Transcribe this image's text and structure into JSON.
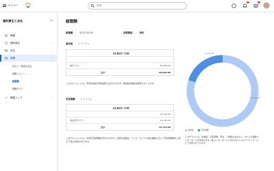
{
  "topbar": {
    "menu_label": "メニュー",
    "search_placeholder": "検索",
    "inbox_badge": "3",
    "notif_badge": "5"
  },
  "sidebar": {
    "title": "福利厚生と支払",
    "items": [
      {
        "label": "概要"
      },
      {
        "label": "福利厚生"
      },
      {
        "label": "支払"
      },
      {
        "label": "報酬"
      }
    ],
    "sub_items": [
      {
        "label": "賞与と一時金の支払"
      },
      {
        "label": "報酬レビュー..."
      },
      {
        "label": "総報酬"
      },
      {
        "label": "報酬サマリ"
      }
    ],
    "extra_item": {
      "label": "関連リンク"
    }
  },
  "main": {
    "title": "総報酬",
    "total_label": "総報酬",
    "total_value": "$75,125.00",
    "freq_label": "長期頻度",
    "freq_value": "毎年",
    "base": {
      "label": "基本給",
      "count": "2 アイテム",
      "header": "会社負担分 (目標)",
      "rows": [
        {
          "name": "",
          "value": ""
        },
        {
          "name": "給与プラン",
          "value": "60,000.00"
        }
      ],
      "total_label": "合計:",
      "total_value": "60,000.00"
    },
    "base_note": "このセクションには、年間基本給が現地通貨で表示されます。時給制労働者は概算されています。",
    "variable": {
      "label": "可変報酬",
      "count": "2 アイテム",
      "header": "会社負担分 (目標)",
      "rows": [
        {
          "name": "",
          "value": "15,125.00"
        },
        {
          "name": "会社賞与プラン",
          "value": "15,125.00"
        }
      ],
      "total_label": "合計:",
      "total_value": "15,125.00"
    },
    "variable_note": "このセクションには、年間可変報酬額が表示されます。実際の金額は、パフォーマンスや会社業績に応じて年間報酬額を上回る/下回る場合があります。"
  },
  "chart_data": {
    "type": "pie",
    "donut": true,
    "categories": [
      "基本給",
      "可変報酬"
    ],
    "values": [
      60000,
      15125
    ],
    "colors": [
      "#aecbf5",
      "#4d8fe0"
    ],
    "value_labels": [
      "60,000.00",
      "15,125.00"
    ]
  },
  "right_note": "このグラフには、基本給、可変報酬、手当、一時金の主なもと、すべての報酬コンポーネントが含まれます。各コンポーネントに表示されているパーセンテージにて計算されています。"
}
